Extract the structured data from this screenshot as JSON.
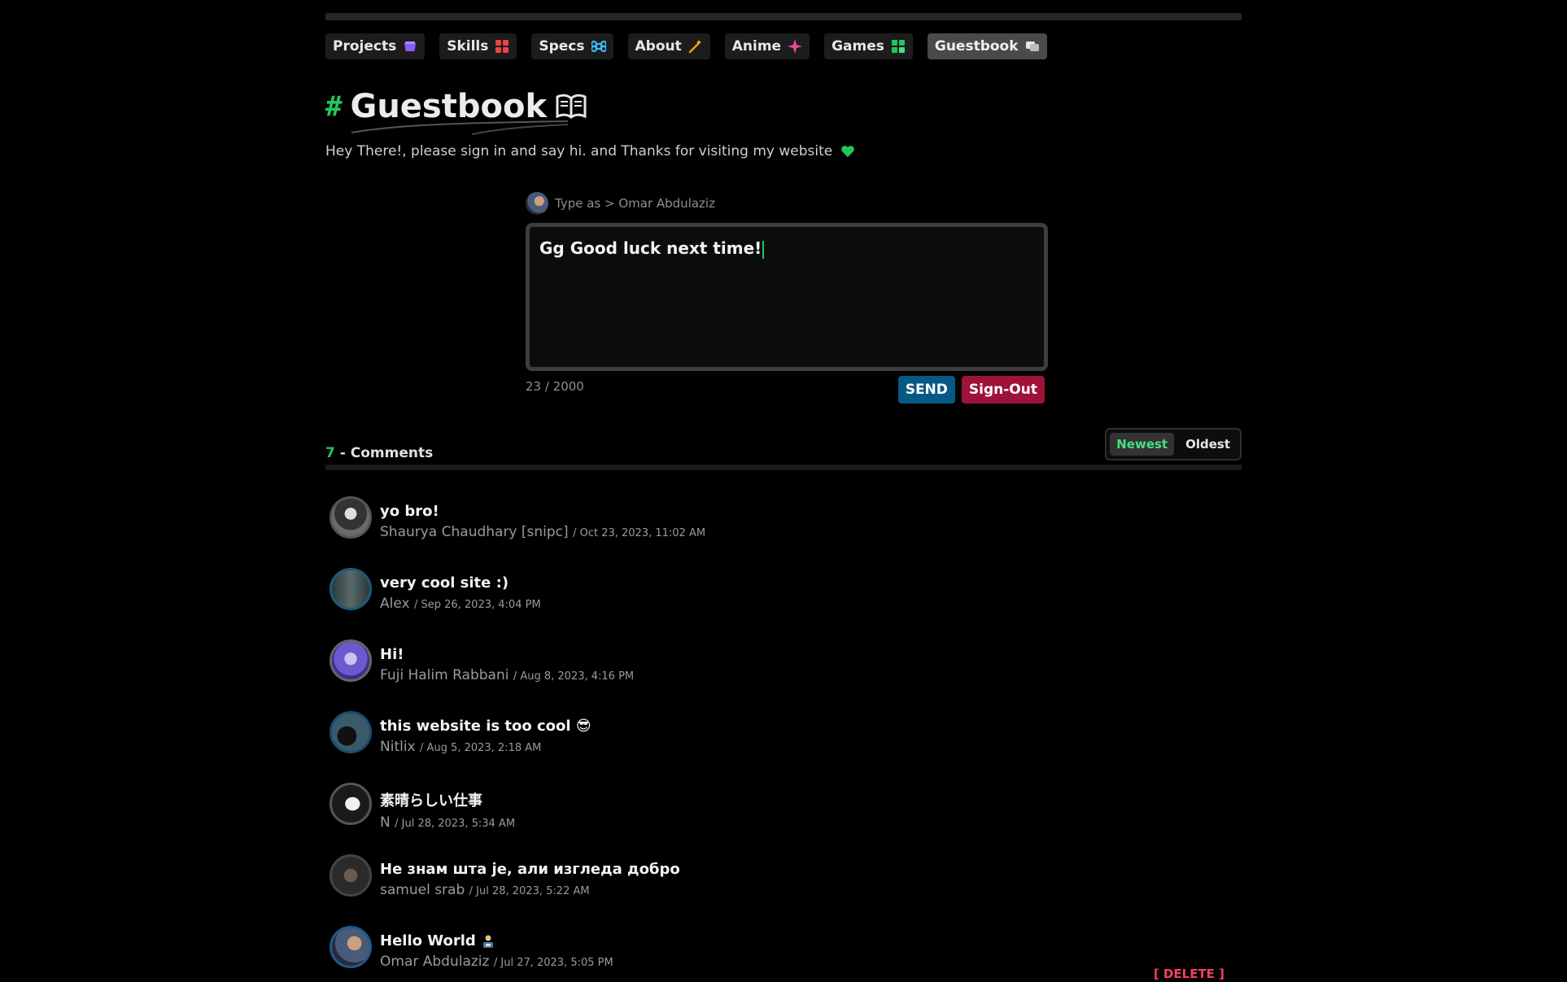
{
  "nav": {
    "items": [
      {
        "label": "Projects",
        "icon": "folder-icon",
        "color": "#8b5cf6",
        "active": false
      },
      {
        "label": "Skills",
        "icon": "grid-icon",
        "color": "#ef4444",
        "active": false
      },
      {
        "label": "Specs",
        "icon": "command-icon",
        "color": "#38bdf8",
        "active": false
      },
      {
        "label": "About",
        "icon": "wand-icon",
        "color": "#f59e0b",
        "active": false
      },
      {
        "label": "Anime",
        "icon": "sparkle-icon",
        "color": "#ec4899",
        "active": false
      },
      {
        "label": "Games",
        "icon": "apps-icon",
        "color": "#22c55e",
        "active": false
      },
      {
        "label": "Guestbook",
        "icon": "chat-icon",
        "color": "#e5e5e5",
        "active": true
      }
    ]
  },
  "page": {
    "hash": "#",
    "title": "Guestbook",
    "title_icon": "book-icon",
    "intro": "Hey There!, please sign in and say hi. and Thanks for visiting my website",
    "intro_icon": "heart-icon",
    "accent": "#22c55e"
  },
  "compose": {
    "type_as": "Type as > Omar Abdulaziz",
    "value": "Gg Good luck next time!",
    "counter": "23 / 2000",
    "send_label": "SEND",
    "signout_label": "Sign-Out"
  },
  "comments_header": {
    "count": "7",
    "label": "- Comments",
    "sort_newest": "Newest",
    "sort_oldest": "Oldest"
  },
  "comments": [
    {
      "text": "yo bro!",
      "author": "Shaurya Chaudhary [snipc]",
      "date": "/ Oct 23, 2023, 11:02 AM",
      "avatar_color": "#6b6b6b"
    },
    {
      "text": "very cool site :)",
      "author": "Alex",
      "date": "/ Sep 26, 2023, 4:04 PM",
      "avatar_color": "#3d5a5a"
    },
    {
      "text": "Hi!",
      "author": "Fuji Halim Rabbani",
      "date": "/ Aug 8, 2023, 4:16 PM",
      "avatar_color": "#6a5acd"
    },
    {
      "text": "this website is too cool 😎",
      "author": "Nitlix",
      "date": "/ Aug 5, 2023, 2:18 AM",
      "avatar_color": "#2b4a5a"
    },
    {
      "text": "素晴らしい仕事",
      "author": "N",
      "date": "/ Jul 28, 2023, 5:34 AM",
      "avatar_color": "#222222"
    },
    {
      "text": "Не знам шта је, али изгледа добро",
      "author": "samuel srab",
      "date": "/ Jul 28, 2023, 5:22 AM",
      "avatar_color": "#3a3a3a"
    },
    {
      "text": "Hello World",
      "author": "Omar Abdulaziz",
      "date": "/ Jul 27, 2023, 5:05 PM",
      "avatar_color": "#4a5a7a",
      "delete_label": "[ DELETE ]"
    }
  ]
}
